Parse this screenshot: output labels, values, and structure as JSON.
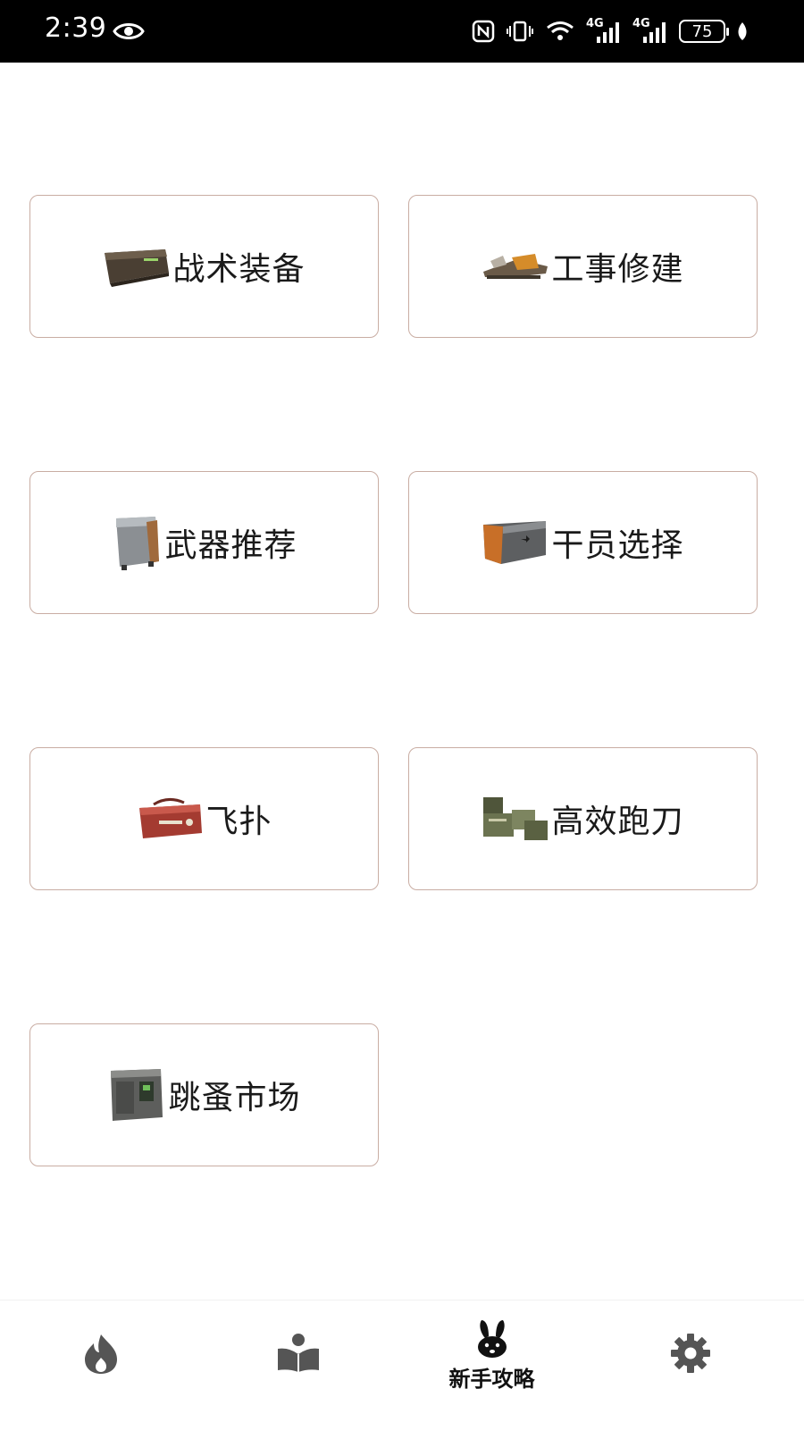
{
  "status_bar": {
    "time": "2:39",
    "battery": "75",
    "icons": [
      "eye-icon",
      "nfc-icon",
      "vibrate-icon",
      "wifi-icon",
      "signal-4g-icon",
      "signal-4g-icon",
      "battery-icon",
      "leaf-icon"
    ],
    "network_label": "4G"
  },
  "grid": {
    "items": [
      {
        "label": "战术装备",
        "icon": "tactical-crate-icon"
      },
      {
        "label": "工事修建",
        "icon": "construction-tool-icon"
      },
      {
        "label": "武器推荐",
        "icon": "weapon-case-icon"
      },
      {
        "label": "干员选择",
        "icon": "operator-crate-icon"
      },
      {
        "label": "飞扑",
        "icon": "red-bag-icon"
      },
      {
        "label": "高效跑刀",
        "icon": "supply-crates-icon"
      },
      {
        "label": "跳蚤市场",
        "icon": "market-locker-icon"
      }
    ]
  },
  "tab_bar": {
    "tabs": [
      {
        "icon": "flame-icon",
        "label": ""
      },
      {
        "icon": "reader-icon",
        "label": ""
      },
      {
        "icon": "bunny-icon",
        "label": "新手攻略"
      },
      {
        "icon": "gear-icon",
        "label": ""
      }
    ],
    "active_index": 2
  },
  "colors": {
    "card_border": "#c9ada3",
    "tab_icon": "#555555",
    "status_bar_bg": "#000000"
  }
}
